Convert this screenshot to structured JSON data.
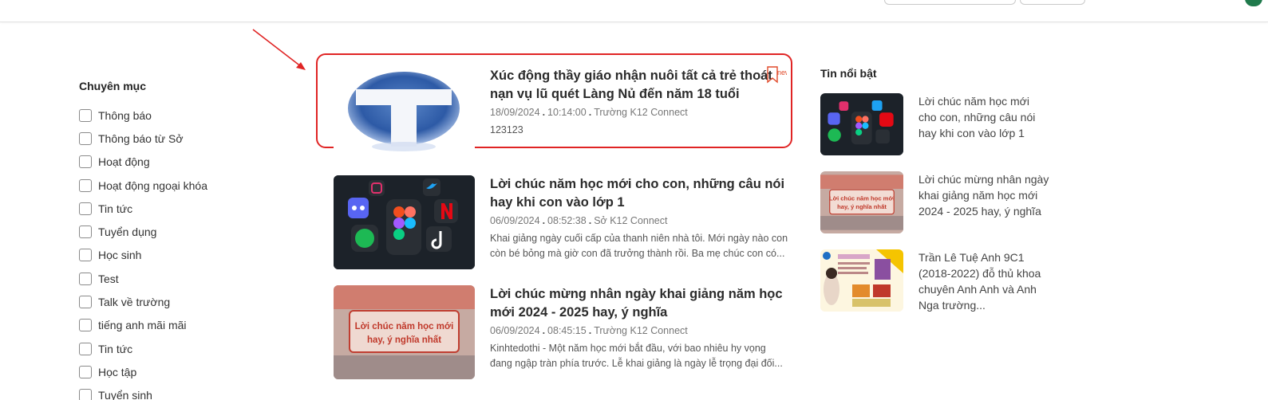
{
  "sidebar": {
    "title": "Chuyên mục",
    "categories": [
      "Thông báo",
      "Thông báo từ Sở",
      "Hoạt động",
      "Hoạt động ngoại khóa",
      "Tin tức",
      "Tuyển dụng",
      "Học sinh",
      "Test",
      "Talk về trường",
      "tiếng anh mãi mãi",
      "Tin tức",
      "Học tập",
      "Tuyển sinh"
    ]
  },
  "articles": [
    {
      "title": "Xúc động thầy giáo nhận nuôi tất cả trẻ thoát nạn vụ lũ quét Làng Nủ đến năm 18 tuổi",
      "date": "18/09/2024",
      "time": "10:14:00",
      "source": "Trường K12 Connect",
      "excerpt": "123123",
      "badge": "new",
      "thumb_icon": "letter-t-logo"
    },
    {
      "title": "Lời chúc năm học mới cho con, những câu nói hay khi con vào lớp 1",
      "date": "06/09/2024",
      "time": "08:52:38",
      "source": "Sở K12 Connect",
      "excerpt": "Khai giảng ngày cuối cấp của thanh niên nhà tôi. Mới ngày nào con còn bé bỏng mà giờ con đã trưởng thành rồi. Ba mẹ chúc con có...",
      "thumb_icon": "social-apps-icons"
    },
    {
      "title": "Lời chúc mừng nhân ngày khai giảng năm học mới 2024 - 2025 hay, ý nghĩa",
      "date": "06/09/2024",
      "time": "08:45:15",
      "source": "Trường K12 Connect",
      "excerpt": "Kinhtedothi - Một năm học mới bắt đầu, với bao nhiêu hy vọng đang ngập tràn phía trước. Lễ khai giảng là ngày lễ trọng đại đối...",
      "thumb_caption": "Lời chúc năm học mới hay, ý nghĩa nhất"
    }
  ],
  "featured": {
    "title": "Tin nổi bật",
    "items": [
      {
        "text": "Lời chúc năm học mới cho con, những câu nói hay khi con vào lớp 1",
        "thumb_icon": "social-apps-icons"
      },
      {
        "text": "Lời chúc mừng nhân ngày khai giảng năm học mới 2024 - 2025 hay, ý nghĩa",
        "thumb_caption": "Lời chúc năm học mới hay, ý nghĩa nhất"
      },
      {
        "text": "Trần Lê Tuệ Anh 9C1 (2018-2022) đỗ thủ khoa chuyên Anh Anh và Anh Nga trường...",
        "thumb_icon": "student-poster"
      }
    ]
  },
  "colors": {
    "highlight": "#e02424",
    "title_text": "#2b2b2b",
    "meta_text": "#777777",
    "badge": "#e04a2a"
  }
}
